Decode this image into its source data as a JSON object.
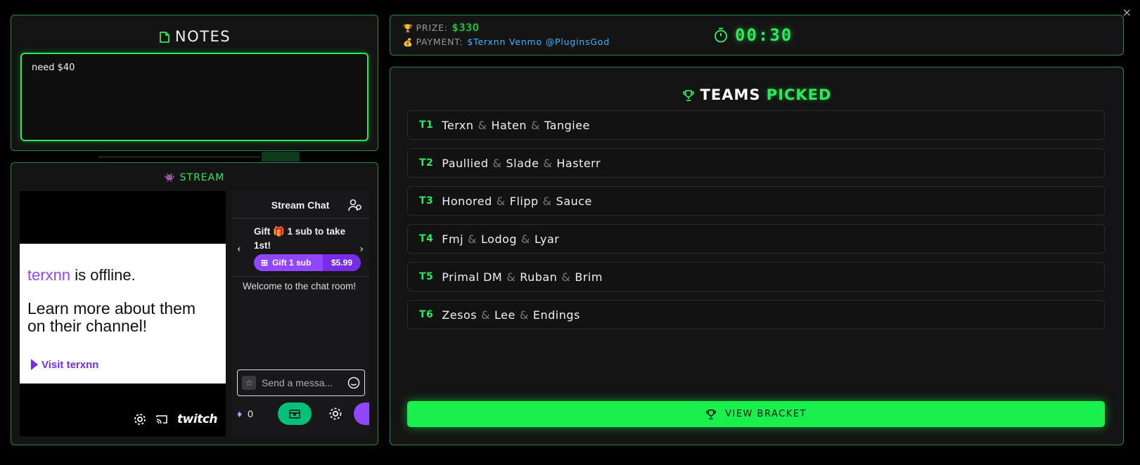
{
  "window": {
    "close_label": "×"
  },
  "notes": {
    "title": "NOTES",
    "content": "need $40"
  },
  "stream": {
    "title": "STREAM",
    "emoji": "👾",
    "player": {
      "channel": "terxnn",
      "offline_suffix": " is offline.",
      "learn_more": "Learn more about them on their channel!",
      "visit_label": "Visit terxnn",
      "brand": "twitch"
    },
    "chat": {
      "header": "Stream Chat",
      "gift_text": "Gift 🎁 1 sub to take 1st!",
      "gift_button_label": "Gift 1 sub",
      "gift_price": "$5.99",
      "welcome": "Welcome to the chat room!",
      "input_placeholder": "Send a messa...",
      "bits_count": "0"
    }
  },
  "topbar": {
    "prize_label": "PRIZE:",
    "prize_value": "$330",
    "payment_label": "PAYMENT:",
    "payment_value": "$Terxnn Venmo @PluginsGod",
    "timer": "00:30"
  },
  "teams": {
    "title_a": "TEAMS",
    "title_b": "PICKED",
    "list": [
      {
        "id": "T1",
        "players": [
          "Terxn",
          "Haten",
          "Tangiee"
        ]
      },
      {
        "id": "T2",
        "players": [
          "Paullied",
          "Slade",
          "Hasterr"
        ]
      },
      {
        "id": "T3",
        "players": [
          "Honored",
          "Flipp",
          "Sauce"
        ]
      },
      {
        "id": "T4",
        "players": [
          "Fmj",
          "Lodog",
          "Lyar"
        ]
      },
      {
        "id": "T5",
        "players": [
          "Primal DM",
          "Ruban",
          "Brim"
        ]
      },
      {
        "id": "T6",
        "players": [
          "Zesos",
          "Lee",
          "Endings"
        ]
      }
    ],
    "view_bracket_label": "VIEW BRACKET",
    "separator": "&"
  },
  "colors": {
    "accent_green": "#2ee85a",
    "twitch_purple": "#9147ff",
    "payment_blue": "#3fb3ff",
    "panel_border": "#1f8a3a"
  }
}
